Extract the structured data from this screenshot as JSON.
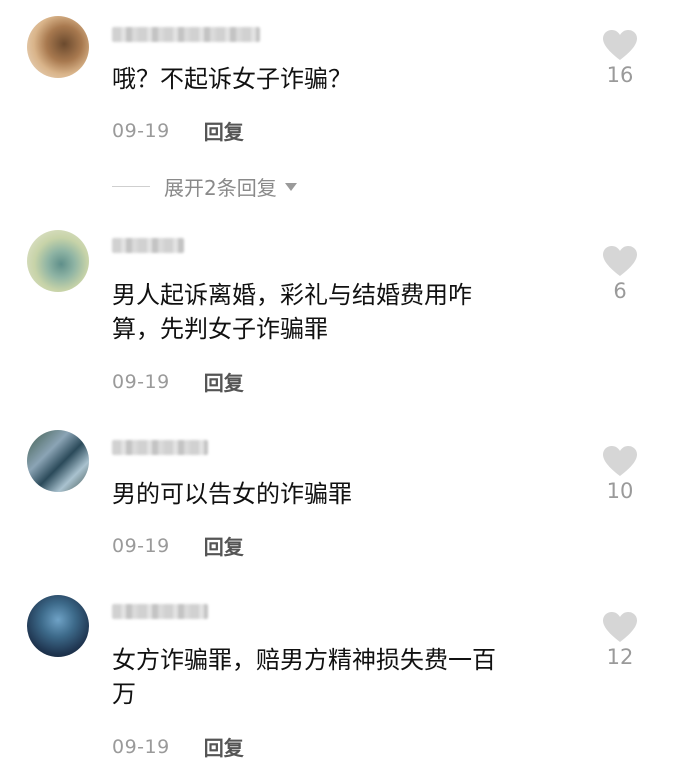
{
  "comments": [
    {
      "text": "哦？不起诉女子诈骗？",
      "date": "09-19",
      "reply_label": "回复",
      "likes": "16",
      "expand_label": "展开2条回复"
    },
    {
      "text": "男人起诉离婚，彩礼与结婚费用咋\n算，先判女子诈骗罪",
      "date": "09-19",
      "reply_label": "回复",
      "likes": "6"
    },
    {
      "text": "男的可以告女的诈骗罪",
      "date": "09-19",
      "reply_label": "回复",
      "likes": "10"
    },
    {
      "text": "女方诈骗罪，赔男方精神损失费一百\n万",
      "date": "09-19",
      "reply_label": "回复",
      "likes": "12"
    }
  ],
  "icons": {
    "like": "heart-icon",
    "expand": "chevron-down-icon"
  },
  "colors": {
    "text": "#111111",
    "meta": "#9a9a9a",
    "like_icon": "#d6d6d6"
  }
}
